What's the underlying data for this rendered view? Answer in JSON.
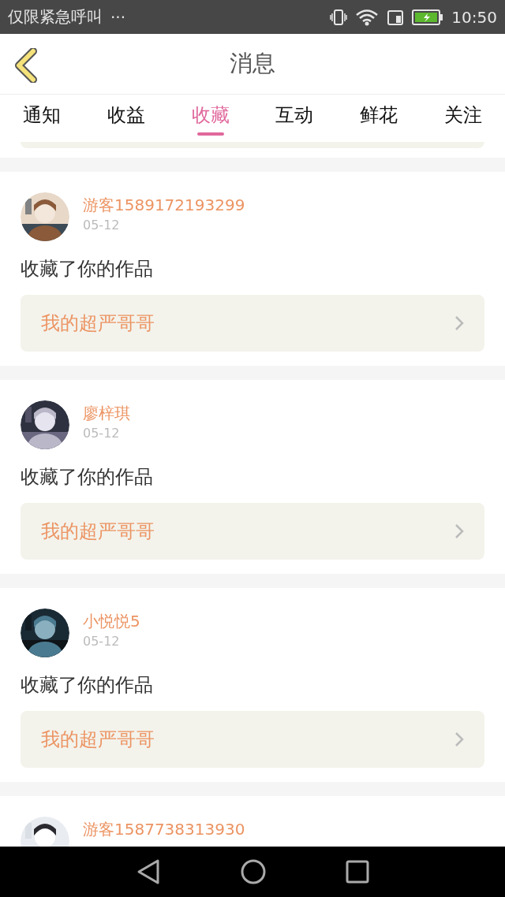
{
  "status_bar": {
    "carrier": "仅限紧急呼叫",
    "more": "···",
    "time": "10:50"
  },
  "header": {
    "title": "消息"
  },
  "tabs": [
    {
      "label": "通知",
      "selected": false
    },
    {
      "label": "收益",
      "selected": false
    },
    {
      "label": "收藏",
      "selected": true
    },
    {
      "label": "互动",
      "selected": false
    },
    {
      "label": "鲜花",
      "selected": false
    },
    {
      "label": "关注",
      "selected": false
    }
  ],
  "messages": [
    {
      "user": "游客1589172193299",
      "date": "05-12",
      "action": "收藏了你的作品",
      "work": "我的超严哥哥"
    },
    {
      "user": "廖梓琪",
      "date": "05-12",
      "action": "收藏了你的作品",
      "work": "我的超严哥哥"
    },
    {
      "user": "小悦悦5",
      "date": "05-12",
      "action": "收藏了你的作品",
      "work": "我的超严哥哥"
    },
    {
      "user": "游客1587738313930"
    }
  ]
}
